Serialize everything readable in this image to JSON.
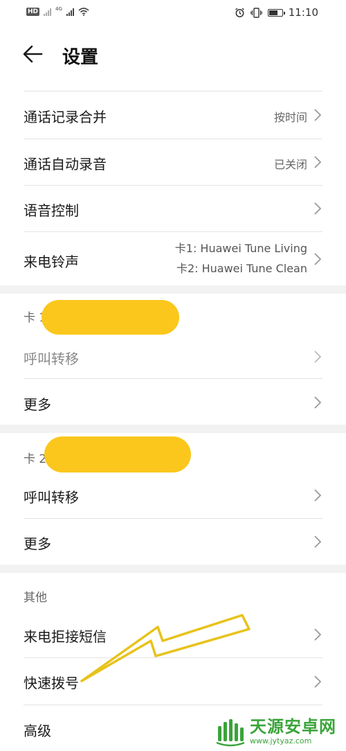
{
  "status_bar": {
    "hd_left": "HD",
    "hd_right": "HD",
    "net_tag": "4G",
    "time": "11:10",
    "battery_level": 0.7
  },
  "header": {
    "title": "设置"
  },
  "rows": {
    "merge": {
      "label": "通话记录合并",
      "value": "按时间"
    },
    "autorecord": {
      "label": "通话自动录音",
      "value": "已关闭"
    },
    "voice": {
      "label": "语音控制"
    },
    "ringtone": {
      "label": "来电铃声",
      "value_line1": "卡1: Huawei Tune Living",
      "value_line2": "卡2: Huawei Tune Clean"
    },
    "card1_forward": {
      "label": "呼叫转移"
    },
    "card1_more": {
      "label": "更多"
    },
    "card2_forward": {
      "label": "呼叫转移"
    },
    "card2_more": {
      "label": "更多"
    },
    "reject_sms": {
      "label": "来电拒接短信"
    },
    "speed_dial": {
      "label": "快速拨号"
    },
    "advanced": {
      "label": "高级"
    }
  },
  "sections": {
    "card1": "卡 1",
    "card2": "卡 2",
    "other": "其他"
  },
  "watermark": {
    "title": "天源安卓网",
    "url": "www.jytyaz.com"
  },
  "colors": {
    "redaction": "#fbc71c",
    "annotation_arrow": "#e8c21a",
    "watermark": "#3aa43a"
  }
}
